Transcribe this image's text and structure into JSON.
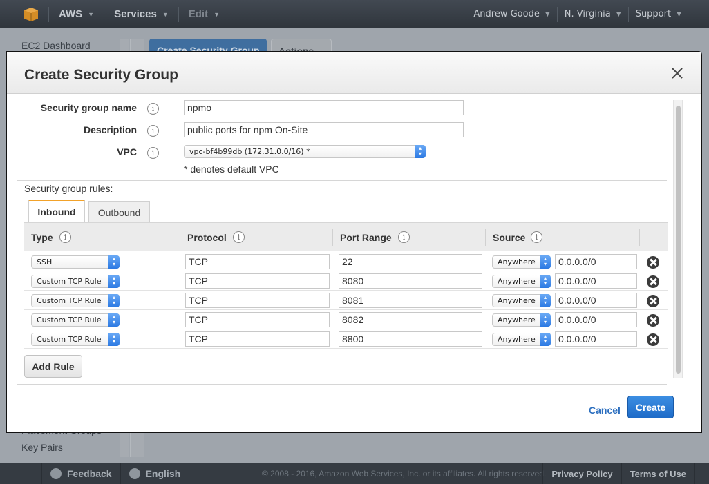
{
  "topnav": {
    "brand": "AWS",
    "services": "Services",
    "edit": "Edit",
    "user": "Andrew Goode",
    "region": "N. Virginia",
    "support": "Support",
    "caret": "▼"
  },
  "background": {
    "sidebar_items": [
      "EC2 Dashboard",
      "Placement Groups",
      "Key Pairs"
    ],
    "create_button": "Create Security Group",
    "actions_button": "Actions"
  },
  "modal": {
    "title": "Create Security Group",
    "fields": {
      "name_label": "Security group name",
      "name_value": "npmo",
      "description_label": "Description",
      "description_value": "public ports for npm On-Site",
      "vpc_label": "VPC",
      "vpc_value": "vpc-bf4b99db (172.31.0.0/16) *",
      "vpc_note": "* denotes default VPC"
    },
    "rules_label": "Security group rules:",
    "tabs": [
      "Inbound",
      "Outbound"
    ],
    "active_tab": "Inbound",
    "columns": [
      "Type",
      "Protocol",
      "Port Range",
      "Source"
    ],
    "rules": [
      {
        "type": "SSH",
        "protocol": "TCP",
        "port": "22",
        "source": "Anywhere",
        "cidr": "0.0.0.0/0"
      },
      {
        "type": "Custom TCP Rule",
        "protocol": "TCP",
        "port": "8080",
        "source": "Anywhere",
        "cidr": "0.0.0.0/0"
      },
      {
        "type": "Custom TCP Rule",
        "protocol": "TCP",
        "port": "8081",
        "source": "Anywhere",
        "cidr": "0.0.0.0/0"
      },
      {
        "type": "Custom TCP Rule",
        "protocol": "TCP",
        "port": "8082",
        "source": "Anywhere",
        "cidr": "0.0.0.0/0"
      },
      {
        "type": "Custom TCP Rule",
        "protocol": "TCP",
        "port": "8800",
        "source": "Anywhere",
        "cidr": "0.0.0.0/0"
      }
    ],
    "add_rule": "Add Rule",
    "cancel": "Cancel",
    "create": "Create",
    "info_glyph": "i",
    "select_arrows": "⌃⌄"
  },
  "footer": {
    "feedback": "Feedback",
    "language": "English",
    "copyright": "© 2008 - 2016, Amazon Web Services, Inc. or its affiliates. All rights reserved.",
    "privacy": "Privacy Policy",
    "terms": "Terms of Use"
  },
  "colors": {
    "nav_bg": "#353b42",
    "primary": "#2b79d3",
    "tab_accent": "#f2a22a",
    "link": "#2c6fbf"
  }
}
